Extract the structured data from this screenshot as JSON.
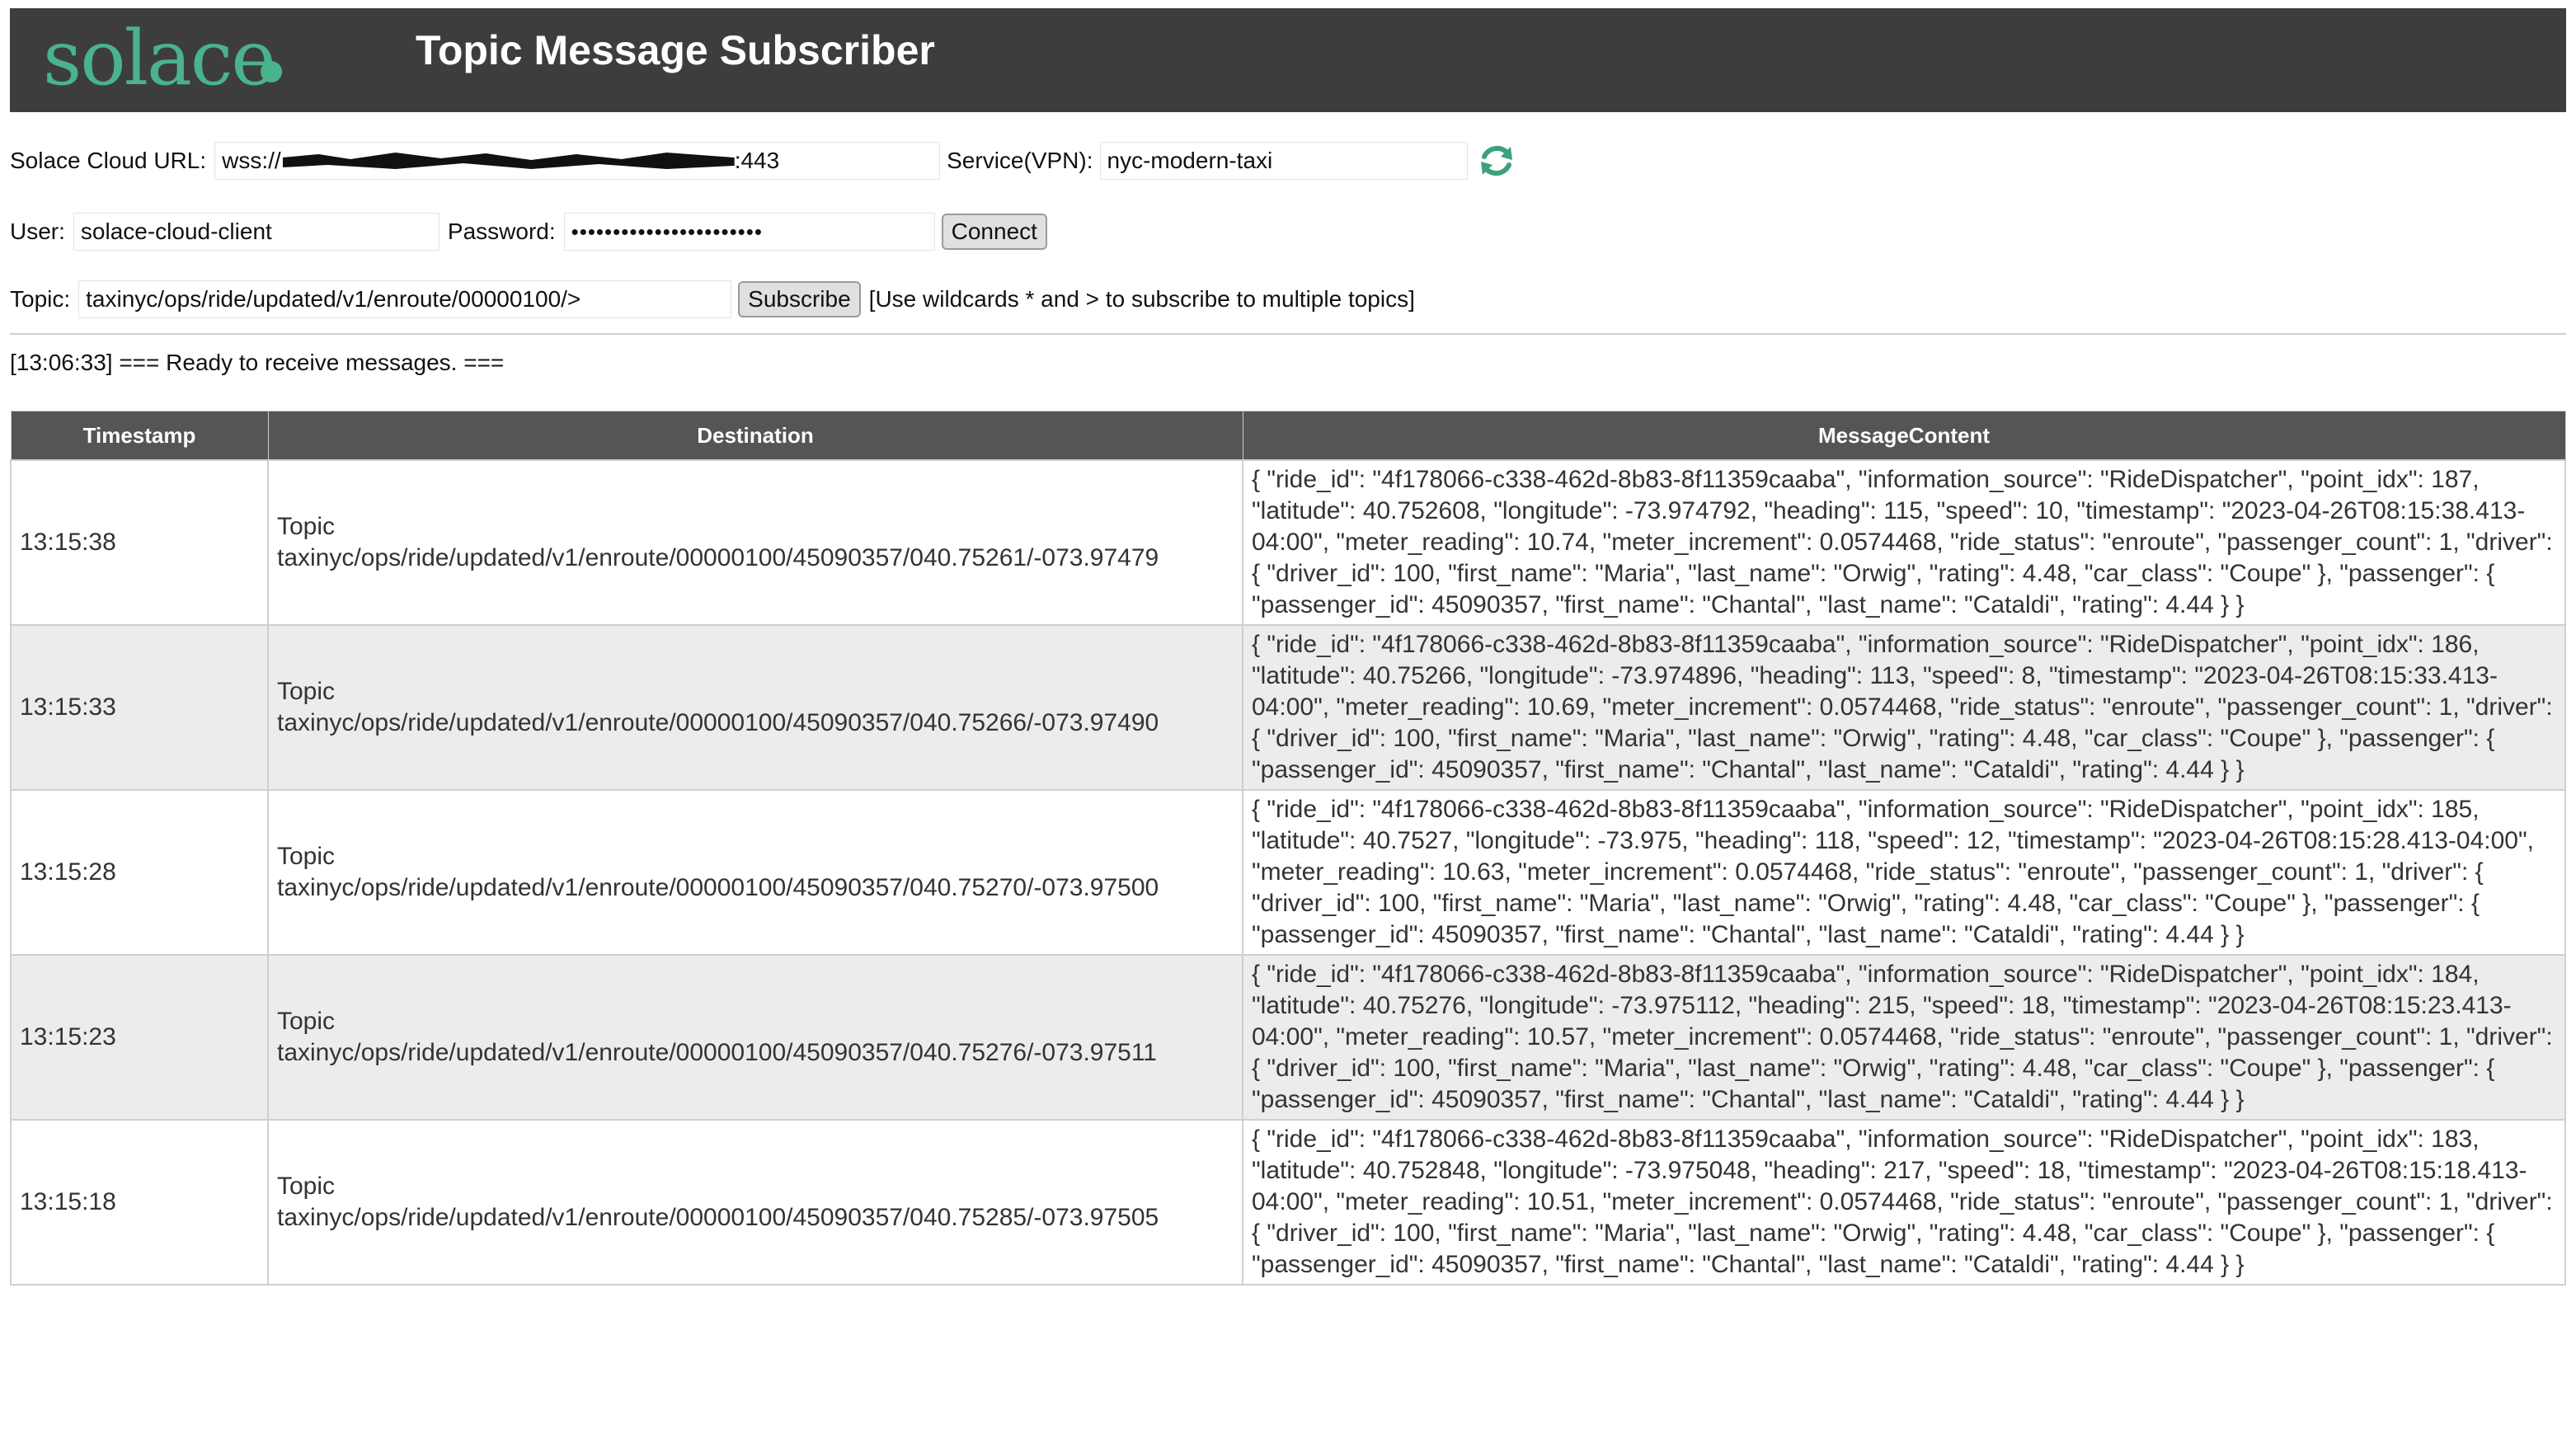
{
  "header": {
    "logo_text": "solace",
    "title": "Topic Message Subscriber",
    "accent_color": "#49b38c",
    "bar_color": "#3d3d3d"
  },
  "connection": {
    "url_label": "Solace Cloud URL:",
    "url_prefix": "wss://",
    "url_suffix": ":443",
    "vpn_label": "Service(VPN):",
    "vpn_value": "nyc-modern-taxi",
    "refresh_icon": "refresh-icon",
    "user_label": "User:",
    "user_value": "solace-cloud-client",
    "password_label": "Password:",
    "password_value": "•••••••••••••••••••••••",
    "connect_label": "Connect"
  },
  "subscription": {
    "topic_label": "Topic:",
    "topic_value": "taxinyc/ops/ride/updated/v1/enroute/00000100/>",
    "subscribe_label": "Subscribe",
    "hint": "[Use wildcards * and > to subscribe to multiple topics]"
  },
  "status": "[13:06:33] === Ready to receive messages. ===",
  "table": {
    "headers": [
      "Timestamp",
      "Destination",
      "MessageContent"
    ],
    "rows": [
      {
        "timestamp": "13:15:38",
        "dest_type": "Topic",
        "dest_topic": "taxinyc/ops/ride/updated/v1/enroute/00000100/45090357/040.75261/-073.97479",
        "content": "{ \"ride_id\": \"4f178066-c338-462d-8b83-8f11359caaba\", \"information_source\": \"RideDispatcher\", \"point_idx\": 187, \"latitude\": 40.752608, \"longitude\": -73.974792, \"heading\": 115, \"speed\": 10, \"timestamp\": \"2023-04-26T08:15:38.413-04:00\", \"meter_reading\": 10.74, \"meter_increment\": 0.0574468, \"ride_status\": \"enroute\", \"passenger_count\": 1, \"driver\": { \"driver_id\": 100, \"first_name\": \"Maria\", \"last_name\": \"Orwig\", \"rating\": 4.48, \"car_class\": \"Coupe\" }, \"passenger\": { \"passenger_id\": 45090357, \"first_name\": \"Chantal\", \"last_name\": \"Cataldi\", \"rating\": 4.44 } }"
      },
      {
        "timestamp": "13:15:33",
        "dest_type": "Topic",
        "dest_topic": "taxinyc/ops/ride/updated/v1/enroute/00000100/45090357/040.75266/-073.97490",
        "content": "{ \"ride_id\": \"4f178066-c338-462d-8b83-8f11359caaba\", \"information_source\": \"RideDispatcher\", \"point_idx\": 186, \"latitude\": 40.75266, \"longitude\": -73.974896, \"heading\": 113, \"speed\": 8, \"timestamp\": \"2023-04-26T08:15:33.413-04:00\", \"meter_reading\": 10.69, \"meter_increment\": 0.0574468, \"ride_status\": \"enroute\", \"passenger_count\": 1, \"driver\": { \"driver_id\": 100, \"first_name\": \"Maria\", \"last_name\": \"Orwig\", \"rating\": 4.48, \"car_class\": \"Coupe\" }, \"passenger\": { \"passenger_id\": 45090357, \"first_name\": \"Chantal\", \"last_name\": \"Cataldi\", \"rating\": 4.44 } }"
      },
      {
        "timestamp": "13:15:28",
        "dest_type": "Topic",
        "dest_topic": "taxinyc/ops/ride/updated/v1/enroute/00000100/45090357/040.75270/-073.97500",
        "content": "{ \"ride_id\": \"4f178066-c338-462d-8b83-8f11359caaba\", \"information_source\": \"RideDispatcher\", \"point_idx\": 185, \"latitude\": 40.7527, \"longitude\": -73.975, \"heading\": 118, \"speed\": 12, \"timestamp\": \"2023-04-26T08:15:28.413-04:00\", \"meter_reading\": 10.63, \"meter_increment\": 0.0574468, \"ride_status\": \"enroute\", \"passenger_count\": 1, \"driver\": { \"driver_id\": 100, \"first_name\": \"Maria\", \"last_name\": \"Orwig\", \"rating\": 4.48, \"car_class\": \"Coupe\" }, \"passenger\": { \"passenger_id\": 45090357, \"first_name\": \"Chantal\", \"last_name\": \"Cataldi\", \"rating\": 4.44 } }"
      },
      {
        "timestamp": "13:15:23",
        "dest_type": "Topic",
        "dest_topic": "taxinyc/ops/ride/updated/v1/enroute/00000100/45090357/040.75276/-073.97511",
        "content": "{ \"ride_id\": \"4f178066-c338-462d-8b83-8f11359caaba\", \"information_source\": \"RideDispatcher\", \"point_idx\": 184, \"latitude\": 40.75276, \"longitude\": -73.975112, \"heading\": 215, \"speed\": 18, \"timestamp\": \"2023-04-26T08:15:23.413-04:00\", \"meter_reading\": 10.57, \"meter_increment\": 0.0574468, \"ride_status\": \"enroute\", \"passenger_count\": 1, \"driver\": { \"driver_id\": 100, \"first_name\": \"Maria\", \"last_name\": \"Orwig\", \"rating\": 4.48, \"car_class\": \"Coupe\" }, \"passenger\": { \"passenger_id\": 45090357, \"first_name\": \"Chantal\", \"last_name\": \"Cataldi\", \"rating\": 4.44 } }"
      },
      {
        "timestamp": "13:15:18",
        "dest_type": "Topic",
        "dest_topic": "taxinyc/ops/ride/updated/v1/enroute/00000100/45090357/040.75285/-073.97505",
        "content": "{ \"ride_id\": \"4f178066-c338-462d-8b83-8f11359caaba\", \"information_source\": \"RideDispatcher\", \"point_idx\": 183, \"latitude\": 40.752848, \"longitude\": -73.975048, \"heading\": 217, \"speed\": 18, \"timestamp\": \"2023-04-26T08:15:18.413-04:00\", \"meter_reading\": 10.51, \"meter_increment\": 0.0574468, \"ride_status\": \"enroute\", \"passenger_count\": 1, \"driver\": { \"driver_id\": 100, \"first_name\": \"Maria\", \"last_name\": \"Orwig\", \"rating\": 4.48, \"car_class\": \"Coupe\" }, \"passenger\": { \"passenger_id\": 45090357, \"first_name\": \"Chantal\", \"last_name\": \"Cataldi\", \"rating\": 4.44 } }"
      }
    ]
  }
}
